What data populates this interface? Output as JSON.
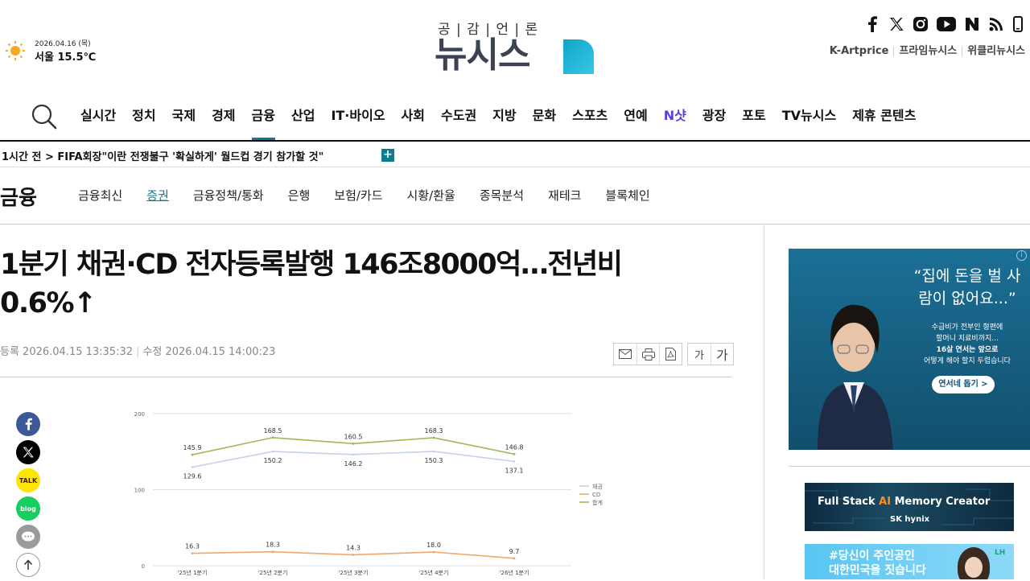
{
  "weather": {
    "date": "2026.04.16 (목)",
    "temp": "서울 15.5℃"
  },
  "logo": {
    "slogan": "공 | 감 | 언 | 론",
    "word": "뉴시스"
  },
  "social": [
    "facebook-icon",
    "x-icon",
    "instagram-icon",
    "youtube-icon",
    "naver-icon",
    "rss-icon",
    "mobile-icon"
  ],
  "toplinks": [
    "K-Artprice",
    "프라임뉴시스",
    "위클리뉴시스"
  ],
  "nav": {
    "items": [
      "실시간",
      "정치",
      "국제",
      "경제",
      "금융",
      "산업",
      "IT·바이오",
      "사회",
      "수도권",
      "지방",
      "문화",
      "스포츠",
      "연예",
      "N샷",
      "광장",
      "포토",
      "TV뉴시스",
      "제휴 콘텐츠"
    ],
    "active": "금융"
  },
  "ticker": {
    "text": "1시간 전 > FIFA회장\"이란 전쟁불구 '확실하게' 월드컵 경기 참가할 것\""
  },
  "section": {
    "title": "금융",
    "items": [
      "금융최신",
      "증권",
      "금융정책/통화",
      "은행",
      "보험/카드",
      "시황/환율",
      "종목분석",
      "재테크",
      "블록체인"
    ],
    "active": "증권"
  },
  "article": {
    "headline": "1분기 채권·CD 전자등록발행 146조8000억…전년비 0.6%↑",
    "registered": "등록 2026.04.15 13:35:32",
    "modified": "수정 2026.04.15 14:00:23",
    "font_small": "가",
    "font_large": "가"
  },
  "share": {
    "kakao": "TALK",
    "blog": "blog"
  },
  "chart_data": {
    "type": "line",
    "categories": [
      "'25년 1분기",
      "'25년 2분기",
      "'25년 3분기",
      "'25년 4분기",
      "'26년 1분기"
    ],
    "ylim": [
      0,
      200
    ],
    "yticks": [
      "0",
      "100",
      "200"
    ],
    "series": [
      {
        "name": "채권",
        "values": [
          129.6,
          150.2,
          146.2,
          150.3,
          137.1
        ],
        "color": "#c5d3e8"
      },
      {
        "name": "CD",
        "values": [
          16.3,
          18.3,
          14.3,
          18.0,
          9.7
        ],
        "color": "#f0a868"
      },
      {
        "name": "합계",
        "values": [
          145.9,
          168.5,
          160.5,
          168.3,
          146.8
        ],
        "color": "#9bbb59"
      }
    ],
    "labels": [
      [
        "129.6",
        "150.2",
        "146.2",
        "150.3",
        "137.1"
      ],
      [
        "16.3",
        "18.3",
        "14.3",
        "18.0",
        "9.7"
      ],
      [
        "145.9",
        "168.5",
        "160.5",
        "168.3",
        "146.8"
      ]
    ],
    "legend_position": "right"
  },
  "ads": {
    "ad1": {
      "quote": "“집에 돈을 벌 사람이 없어요...”",
      "body1": "수급비가 전부인 형편에",
      "body2": "할머니 치료비까지...",
      "body3": "16살 연서는 앞으로",
      "body4": "어떻게 해야 할지 두렵습니다",
      "cta": "연서네 돕기 >"
    },
    "ad2": {
      "text_a": "Full Stack ",
      "text_b": "AI",
      "text_c": " Memory Creator",
      "brand": "SK hynix"
    },
    "ad3": {
      "line1_a": "#당신이 주인공인",
      "line2": "대한민국을 짓습니다",
      "brand": "LH"
    }
  }
}
